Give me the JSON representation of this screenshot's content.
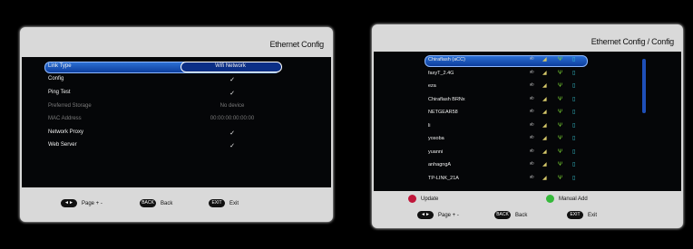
{
  "left": {
    "title": "Ethernet Config",
    "menu": [
      {
        "label": "Link Type",
        "value": "Wifi Network",
        "selected": true,
        "dim": false
      },
      {
        "label": "Config",
        "value": "✓",
        "selected": false,
        "dim": false
      },
      {
        "label": "Ping Test",
        "value": "✓",
        "selected": false,
        "dim": false
      },
      {
        "label": "Preferred Storage",
        "value": "No device",
        "selected": false,
        "dim": true
      },
      {
        "label": "MAC Address",
        "value": "00:00:00:00:00:00",
        "selected": false,
        "dim": true
      },
      {
        "label": "Network Proxy",
        "value": "✓",
        "selected": false,
        "dim": false
      },
      {
        "label": "Web Server",
        "value": "✓",
        "selected": false,
        "dim": false
      }
    ],
    "footer": {
      "page_icon": "◄►",
      "page_label": "Page + -",
      "back_icon": "BACK",
      "back_label": "Back",
      "exit_icon": "EXIT",
      "exit_label": "Exit"
    }
  },
  "right": {
    "title": "Ethernet Config / Config",
    "networks": [
      "Chiraflash (aCC)",
      "faxyT_2.4G",
      "eza",
      "Chiraflash BRNx",
      "NETGEAR58",
      "li",
      "yosoba",
      "yuanni",
      "anhagngA",
      "TP-LINK_21A"
    ],
    "footer": {
      "update_label": "Update",
      "manual_label": "Manual Add",
      "page_icon": "◄►",
      "page_label": "Page + -",
      "back_icon": "BACK",
      "back_label": "Back",
      "exit_icon": "EXIT",
      "exit_label": "Exit"
    },
    "colors": {
      "update": "#c0163a",
      "manual": "#35b93a",
      "signal": "#d6c96a",
      "antenna": "#7ddc34",
      "lock": "#35c8d6"
    }
  }
}
